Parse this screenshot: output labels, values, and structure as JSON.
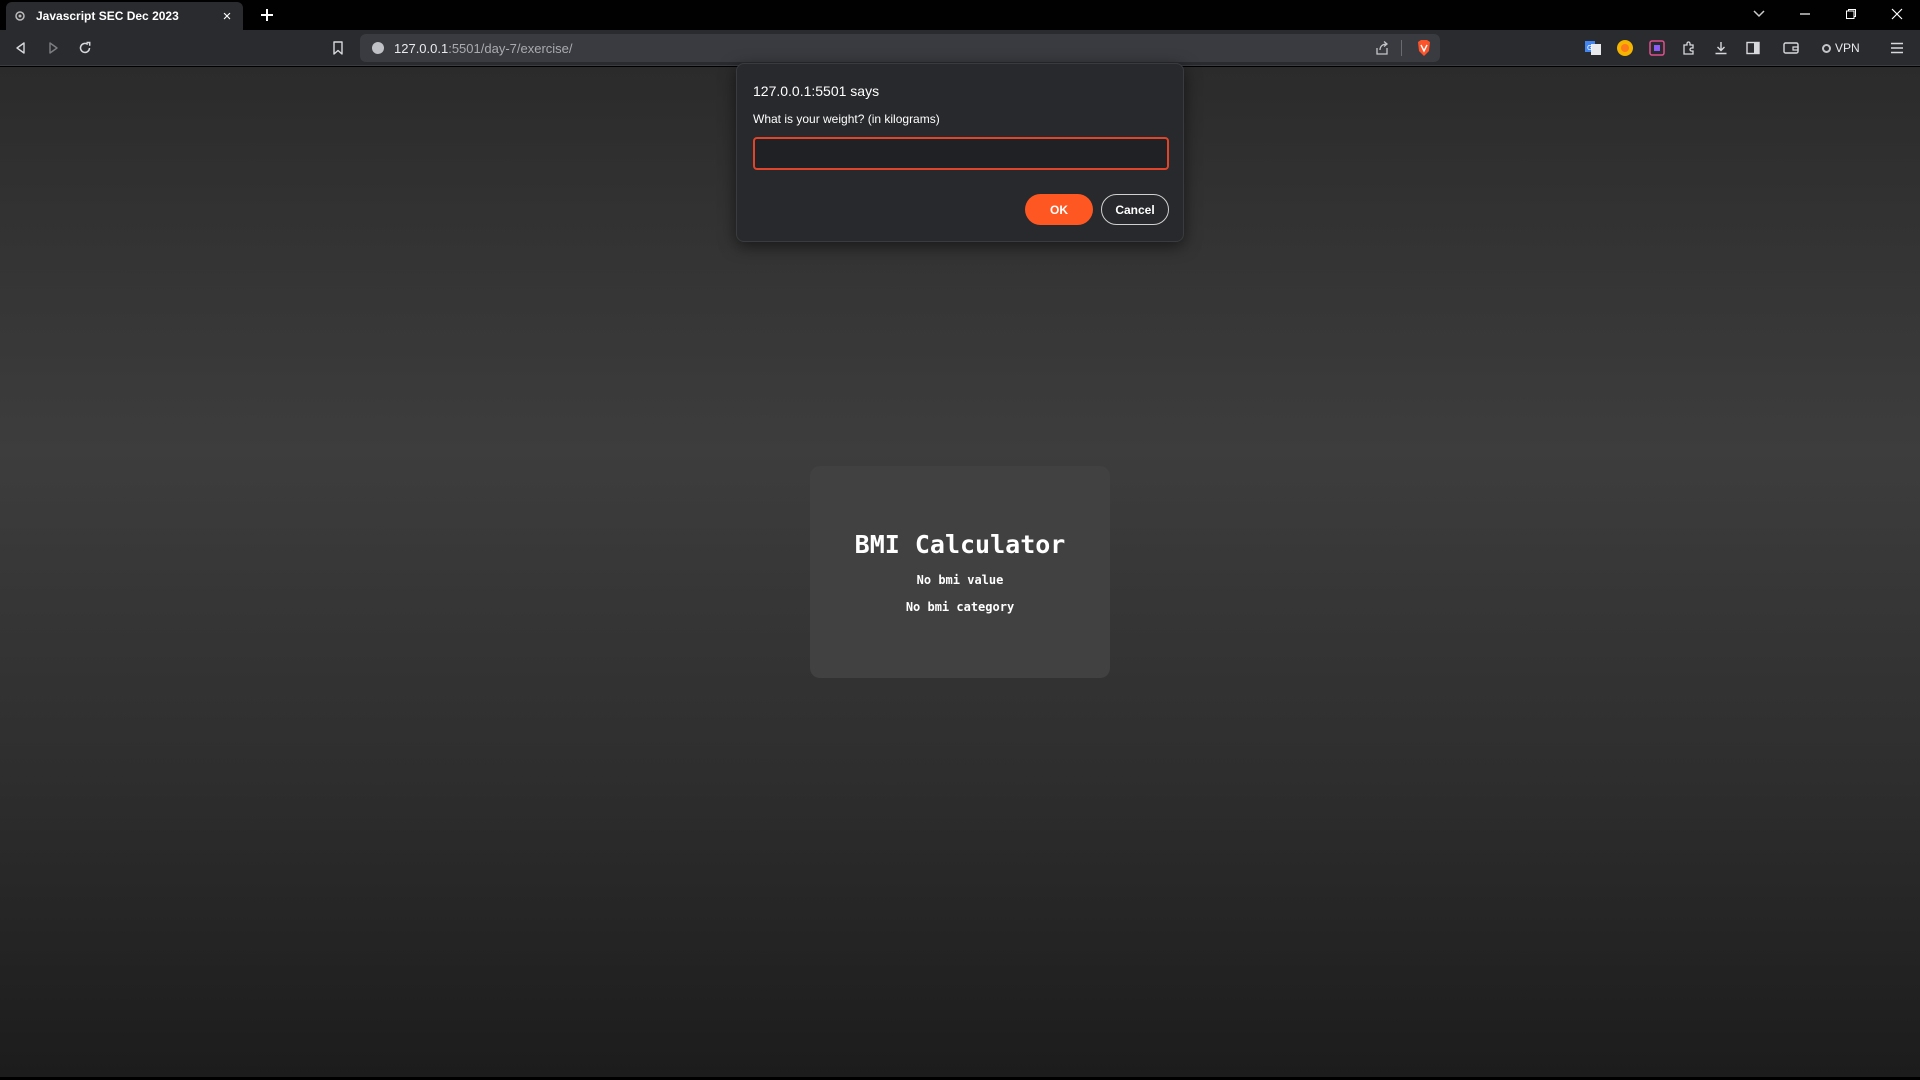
{
  "browser": {
    "tab": {
      "title": "Javascript SEC Dec 2023",
      "close_glyph": "×",
      "favicon": "page-icon"
    },
    "new_tab_glyph": "+",
    "url": {
      "host": "127.0.0.1",
      "rest": ":5501/day-7/exercise/"
    },
    "vpn_label": "VPN"
  },
  "dialog": {
    "origin": "127.0.0.1:5501 says",
    "message": "What is your weight? (in kilograms)",
    "input_value": "",
    "ok_label": "OK",
    "cancel_label": "Cancel"
  },
  "app": {
    "title": "BMI Calculator",
    "bmi_value": "No bmi value",
    "bmi_category": "No bmi category"
  },
  "colors": {
    "accent": "#ff5722",
    "input_border": "#e0442a",
    "card_bg": "#414141"
  }
}
